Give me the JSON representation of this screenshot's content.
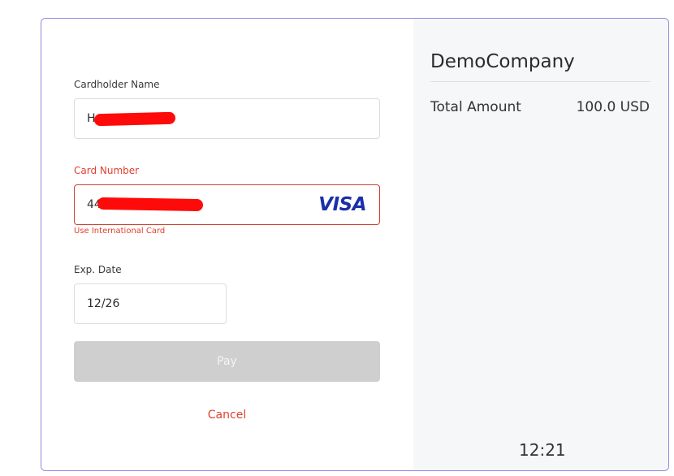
{
  "form": {
    "cardholder_label": "Cardholder Name",
    "cardholder_value": "H                EV",
    "card_number_label": "Card Number",
    "card_number_value": "44",
    "card_brand": "VISA",
    "card_hint": "Use International Card",
    "exp_label": "Exp. Date",
    "exp_value": "12/26",
    "pay_label": "Pay",
    "cancel_label": "Cancel"
  },
  "summary": {
    "company": "DemoCompany",
    "total_label": "Total Amount",
    "total_value": "100.0 USD",
    "timer": "12:21"
  },
  "colors": {
    "accent_border": "#8f86e0",
    "error": "#e0402f",
    "visa": "#1a2fa8",
    "pay_disabled": "#cfcfcf",
    "redaction": "#ff0a0a"
  }
}
